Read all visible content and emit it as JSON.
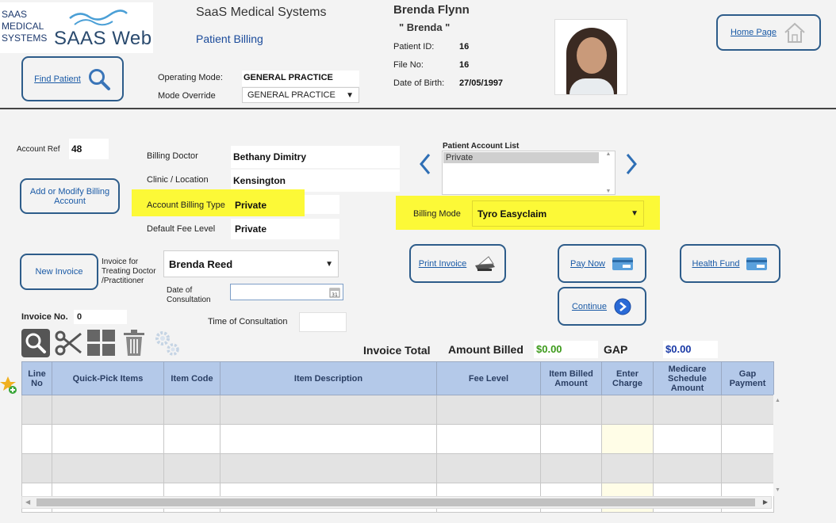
{
  "brand": {
    "logo_text": "SAAS MEDICAL SYSTEMS",
    "logo_word": "SAAS Web"
  },
  "header": {
    "title": "SaaS Medical Systems",
    "subtitle": "Patient Billing"
  },
  "patient": {
    "name": "Brenda Flynn",
    "nickname": "\" Brenda \"",
    "id_label": "Patient ID:",
    "id": "16",
    "file_label": "File No:",
    "file": "16",
    "dob_label": "Date of Birth:",
    "dob": "27/05/1997"
  },
  "nav": {
    "home": "Home Page",
    "find_patient": "Find Patient"
  },
  "mode": {
    "operating_label": "Operating Mode:",
    "operating_value": "GENERAL PRACTICE",
    "override_label": "Mode Override",
    "override_value": "GENERAL PRACTICE"
  },
  "account": {
    "ref_label": "Account Ref",
    "ref_value": "48",
    "billing_doctor_label": "Billing Doctor",
    "billing_doctor": "Bethany Dimitry",
    "clinic_label": "Clinic / Location",
    "clinic": "Kensington",
    "billing_type_label": "Account Billing Type",
    "billing_type": "Private",
    "fee_level_label": "Default Fee Level",
    "fee_level": "Private",
    "add_modify": "Add or Modify Billing Account"
  },
  "account_list": {
    "label": "Patient Account List",
    "items": [
      "Private"
    ]
  },
  "billing_mode": {
    "label": "Billing Mode",
    "value": "Tyro Easyclaim"
  },
  "invoice": {
    "new": "New Invoice",
    "treating_label": "Invoice for Treating Doctor /Practitioner",
    "treating_value": "Brenda Reed",
    "date_label": "Date of Consultation",
    "time_label": "Time of Consultation",
    "no_label": "Invoice No.",
    "no_value": "0"
  },
  "actions": {
    "print": "Print Invoice",
    "pay": "Pay Now",
    "health_fund": "Health Fund",
    "continue": "Continue"
  },
  "totals": {
    "invoice_total": "Invoice Total",
    "amount_billed_label": "Amount Billed",
    "amount_billed": "$0.00",
    "gap_label": "GAP",
    "gap": "$0.00"
  },
  "table": {
    "headers": [
      "Line No",
      "Quick-Pick Items",
      "Item Code",
      "Item Description",
      "Fee Level",
      "Item Billed Amount",
      "Enter Charge",
      "Medicare Schedule Amount",
      "Gap Payment"
    ]
  },
  "colors": {
    "accent": "#2d5c8a",
    "highlight": "#fcf937",
    "header_bg": "#b4c9e9",
    "money_green": "#3c9a1a",
    "money_blue": "#1a3aa6"
  }
}
